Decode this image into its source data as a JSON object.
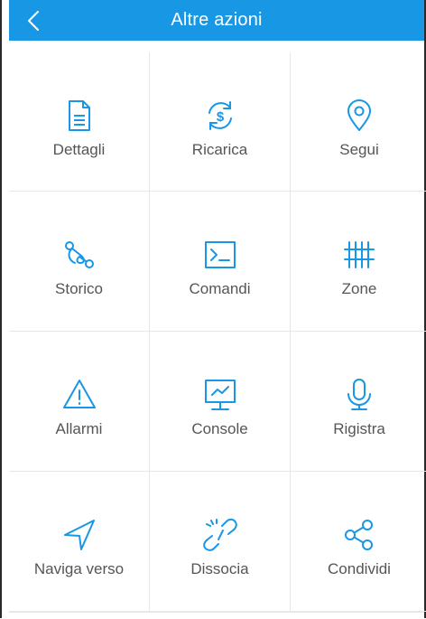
{
  "header": {
    "title": "Altre azioni",
    "back_icon": "chevron-left-icon"
  },
  "colors": {
    "header_bg": "#1897e5",
    "icon": "#1897e5",
    "label": "#555555"
  },
  "actions": [
    {
      "label": "Dettagli",
      "icon": "document-icon"
    },
    {
      "label": "Ricarica",
      "icon": "dollar-refresh-icon"
    },
    {
      "label": "Segui",
      "icon": "map-pin-icon"
    },
    {
      "label": "Storico",
      "icon": "route-icon"
    },
    {
      "label": "Comandi",
      "icon": "terminal-icon"
    },
    {
      "label": "Zone",
      "icon": "fence-icon"
    },
    {
      "label": "Allarmi",
      "icon": "warning-icon"
    },
    {
      "label": "Console",
      "icon": "monitor-chart-icon"
    },
    {
      "label": "Rigistra",
      "icon": "microphone-icon"
    },
    {
      "label": "Naviga verso",
      "icon": "navigation-arrow-icon"
    },
    {
      "label": "Dissocia",
      "icon": "broken-link-icon"
    },
    {
      "label": "Condividi",
      "icon": "share-icon"
    }
  ]
}
